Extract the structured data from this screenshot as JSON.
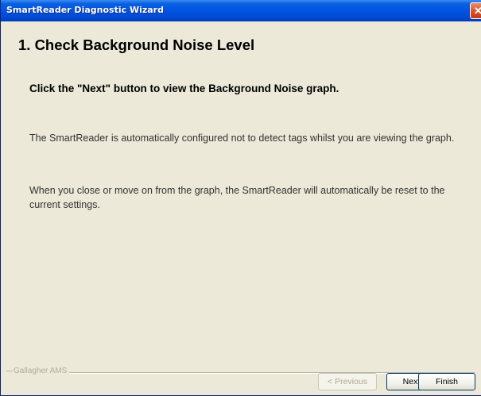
{
  "window": {
    "title": "SmartReader Diagnostic Wizard",
    "close_glyph": "✕"
  },
  "page": {
    "heading": "1. Check Background Noise Level",
    "instruction": "Click the \"Next\" button to view the Background Noise graph.",
    "paragraph1": "The SmartReader is automatically configured not to detect tags whilst you are viewing the graph.",
    "paragraph2": "When you close or move on from the graph, the SmartReader will automatically be reset to the current settings."
  },
  "footer": {
    "brand": "Gallagher AMS",
    "previous_label": "< Previous",
    "next_label": "Next >",
    "finish_label": "Finish"
  },
  "icons": {
    "close": "close-icon"
  },
  "colors": {
    "titlebar": "#0054e3",
    "close_button": "#d8532c",
    "dialog_background": "#ece9d8"
  }
}
